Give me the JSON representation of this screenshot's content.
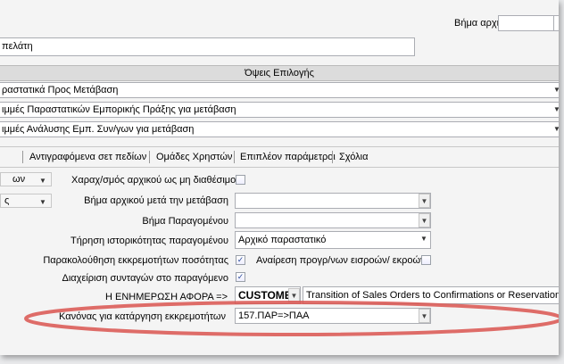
{
  "header": {
    "initial_step_label": "Βήμα αρχικού",
    "initial_step_value": "",
    "customer_field_value": "πελάτη"
  },
  "options_section": {
    "title": "Όψεις Επιλογής",
    "dropdowns": [
      {
        "value": "ραστατικά Προς Μετάβαση"
      },
      {
        "value": "ιμμές Παραστατικών Εμπορικής Πράξης για μετάβαση"
      },
      {
        "value": "ιμμές Ανάλυσης Εμπ. Συν/γων για μετάβαση"
      }
    ]
  },
  "tabs": [
    {
      "label": "Αντιγραφόμενα σετ πεδίων"
    },
    {
      "label": "Ομάδες Χρηστών"
    },
    {
      "label": "Επιπλέον παράμετροι"
    },
    {
      "label": "Σχόλια"
    }
  ],
  "left_combos": [
    {
      "value": "ων"
    },
    {
      "value": "ς"
    }
  ],
  "form": {
    "unavailable_char_label": "Χαραχ/σμός αρχικού ως μη διαθέσιμο",
    "initial_step_after_label": "Βήμα αρχικού μετά την μετάβαση",
    "initial_step_after_value": "",
    "derived_step_label": "Βήμα Παραγομένου",
    "derived_step_value": "",
    "history_label": "Τήρηση ιστορικότητας παραγομένου",
    "history_value": "Αρχικό παραστατικό",
    "pending_qty_label": "Παρακολούθηση εκκρεμοτήτων ποσότητας",
    "remove_io_label": "Αναίρεση προγρ/νων εισροών/ εκροών",
    "recipes_label": "Διαχείριση συνταγών στο παραγόμενο",
    "update_label": "Η ΕΝΗΜΕΡΩΣΗ ΑΦΟΡΑ =>",
    "update_value": "CUSTOMER",
    "update_description": "Transition of Sales Orders to Confirmations or Reservations",
    "rule_label": "Κανόνας για κατάργηση εκκρεμοτήτων",
    "rule_value": "157.ΠΑΡ=>ΠΑΑ"
  },
  "checkboxes": {
    "unavailable_char": false,
    "pending_qty": true,
    "remove_io": false,
    "recipes": true
  },
  "colors": {
    "highlight_ellipse": "#d9534f",
    "section_header_bg": "#dcdcdc"
  }
}
